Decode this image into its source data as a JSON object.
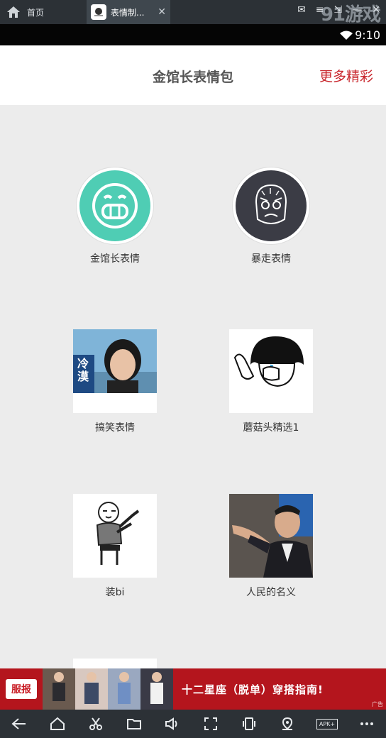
{
  "emulator": {
    "home_label": "首页",
    "tab_label": "表情制...",
    "tab_close": "✕",
    "brand": "91游戏",
    "controls": [
      "✉",
      "≡",
      "⇲",
      "—",
      "✕"
    ]
  },
  "status": {
    "time": "9:10"
  },
  "header": {
    "title": "金馆长表情包",
    "more": "更多精彩"
  },
  "grid": {
    "items": [
      {
        "label": "金馆长表情",
        "kind": "circle",
        "icon": "grin-face-icon",
        "bg": "#4fcdb4"
      },
      {
        "label": "暴走表情",
        "kind": "circle",
        "icon": "rage-face-icon",
        "bg": "#3b3c45"
      },
      {
        "label": "搞笑表情",
        "kind": "thumb",
        "icon": "woman-photo-icon",
        "overlay": "冷漠"
      },
      {
        "label": "蘑菇头精选1",
        "kind": "thumb",
        "icon": "mushroom-head-icon"
      },
      {
        "label": "装bi",
        "kind": "thumb",
        "icon": "pointing-man-icon"
      },
      {
        "label": "人民的名义",
        "kind": "thumb",
        "icon": "suit-man-photo-icon"
      }
    ]
  },
  "ad": {
    "logo": "服报",
    "text": "十二星座（脱单）穿搭指南!",
    "tag": "广告",
    "photo_colors": [
      "#6a5a4f",
      "#d8c8c0",
      "#9aa8c0",
      "#3a3a46"
    ]
  },
  "bottom": {
    "icons": [
      "back-icon",
      "home-icon",
      "scissors-icon",
      "folder-icon",
      "volume-icon",
      "fullscreen-icon",
      "rotate-icon",
      "location-icon",
      "apk-icon",
      "more-icon"
    ],
    "apk_label": "APK+"
  }
}
